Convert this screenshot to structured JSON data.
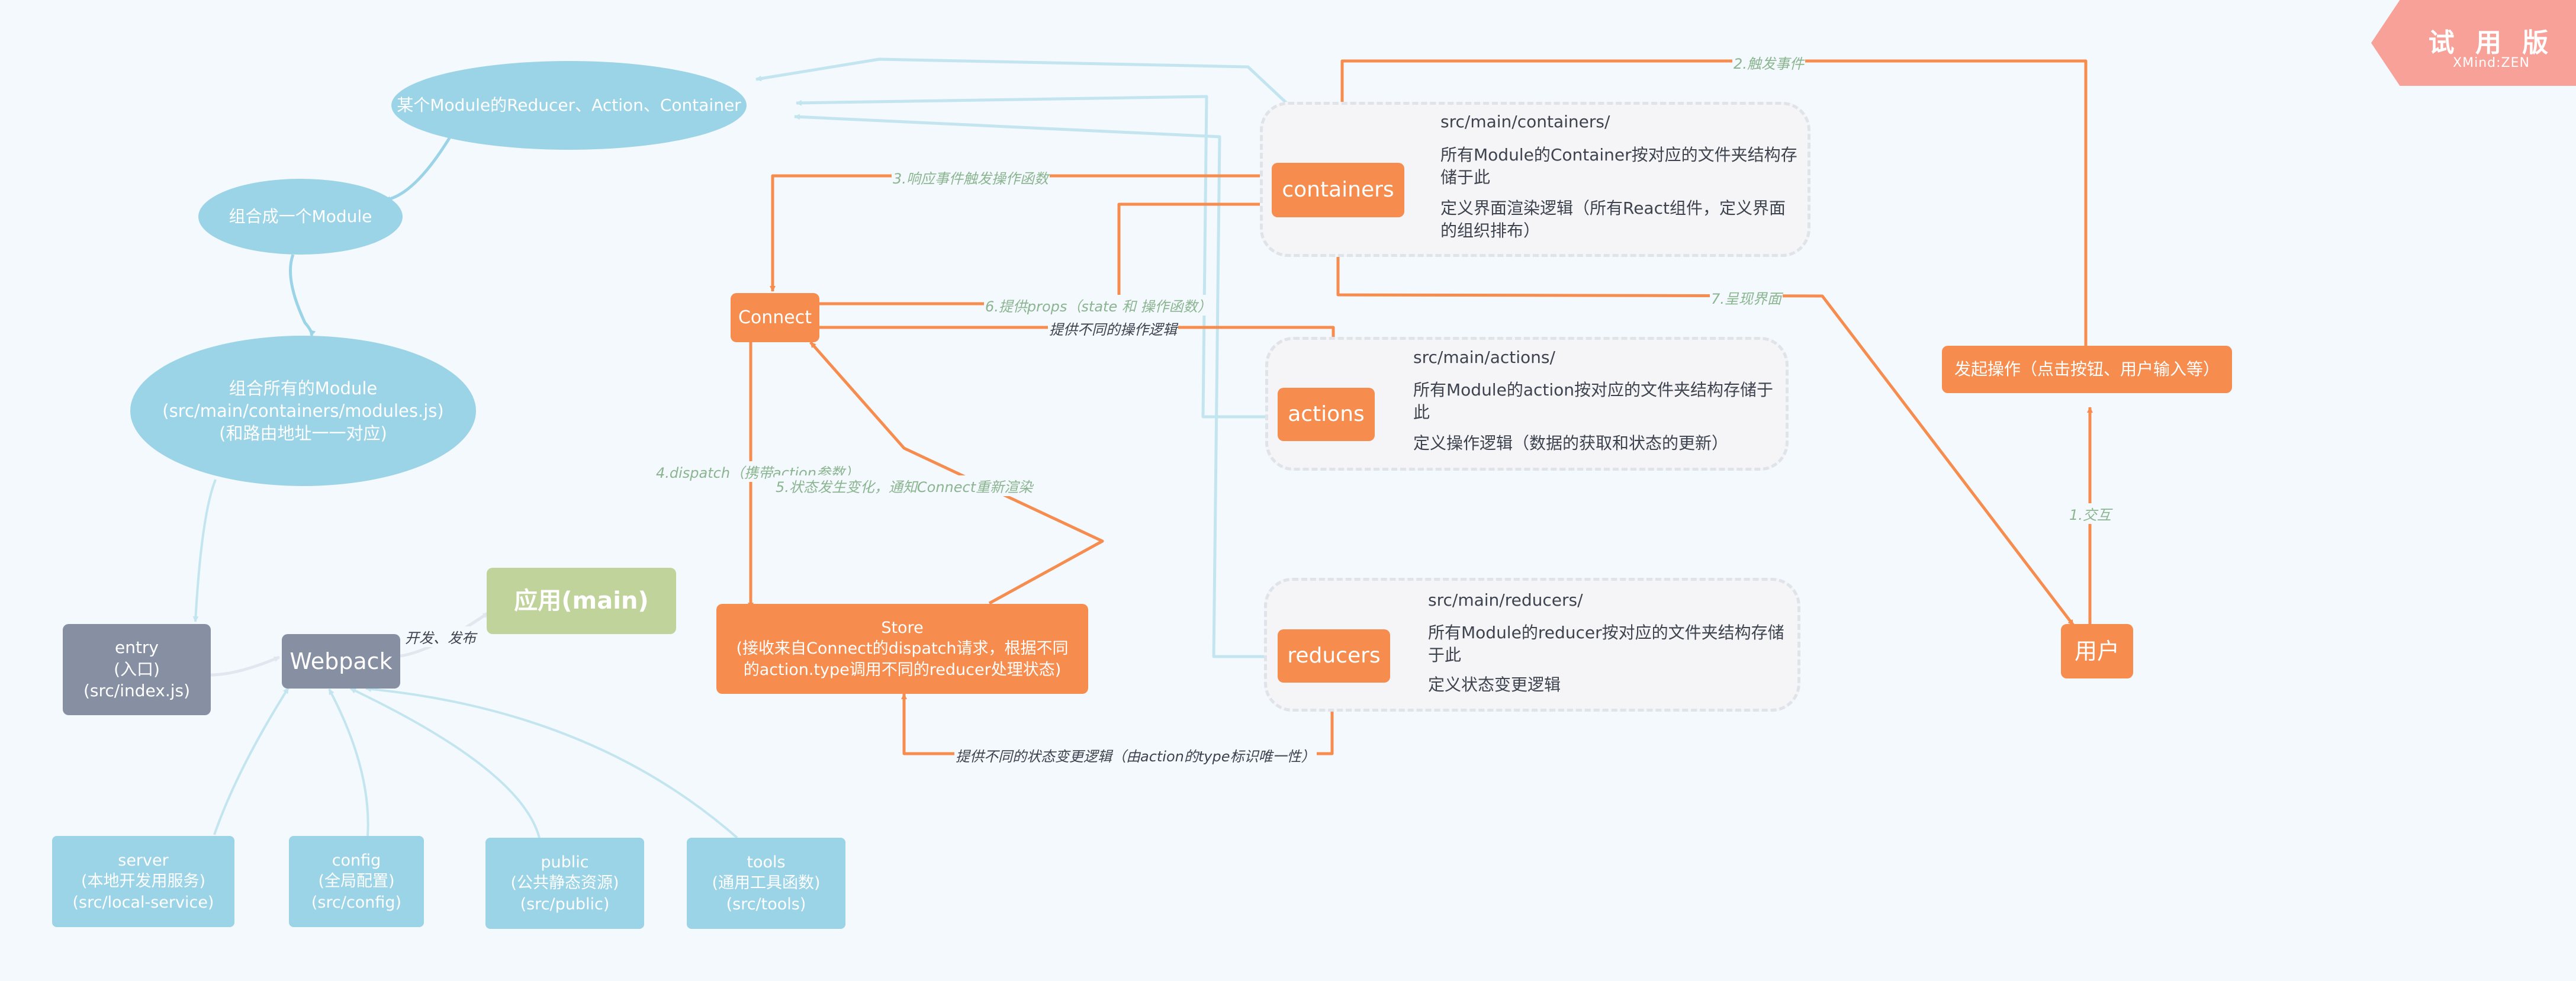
{
  "watermark": {
    "title": "试 用 版",
    "subtitle": "XMind:ZEN",
    "color": "#f8a198"
  },
  "colors": {
    "background": "#f4f9fd",
    "blue_node": "#9bd4e7",
    "blue_line": "#c3e5f0",
    "gray_node": "#8790a3",
    "green_node": "#c0d39b",
    "orange_node": "#f68c4e",
    "edge_label_green": "#8ab590",
    "edge_label_dark": "#3d434e"
  },
  "left_flow": {
    "module_parts": "某个Module的Reducer、Action、Container",
    "combine_one": "组合成一个Module",
    "combine_all": "组合所有的Module\n(src/main/containers/modules.js)\n(和路由地址一一对应)",
    "entry": "entry\n(入口)\n(src/index.js)",
    "webpack": "Webpack",
    "app": "应用(main)",
    "webpack_to_app_label": "开发、发布",
    "sources": [
      {
        "label": "server\n(本地开发用服务)\n(src/local-service)"
      },
      {
        "label": "config\n(全局配置)\n(src/config)"
      },
      {
        "label": "public\n(公共静态资源)\n(src/public)"
      },
      {
        "label": "tools\n(通用工具函数)\n(src/tools)"
      }
    ]
  },
  "redux_flow": {
    "connect": "Connect",
    "store": "Store\n(接收来自Connect的dispatch请求，根据不同的action.type调用不同的reducer处理状态)",
    "containers": {
      "label": "containers",
      "details": [
        "src/main/containers/",
        "所有Module的Container按对应的文件夹结构存储于此",
        "定义界面渲染逻辑（所有React组件，定义界面的组织排布）"
      ]
    },
    "actions": {
      "label": "actions",
      "details": [
        "src/main/actions/",
        "所有Module的action按对应的文件夹结构存储于此",
        "定义操作逻辑（数据的获取和状态的更新）"
      ]
    },
    "reducers": {
      "label": "reducers",
      "details": [
        "src/main/reducers/",
        "所有Module的reducer按对应的文件夹结构存储于此",
        "定义状态变更逻辑"
      ]
    },
    "initiate_action": "发起操作（点击按钮、用户输入等）",
    "user": "用户"
  },
  "edge_labels": {
    "step1": "1.交互",
    "step2": "2.触发事件",
    "step3": "3.响应事件触发操作函数",
    "step4": "4.dispatch（携带action参数）",
    "step5": "5.状态发生变化，通知Connect重新渲染",
    "step6": "6.提供props（state 和 操作函数）",
    "step7": "7.呈现界面",
    "actions_to_connect": "提供不同的操作逻辑",
    "reducers_to_store": "提供不同的状态变更逻辑（由action的type标识唯一性）"
  }
}
